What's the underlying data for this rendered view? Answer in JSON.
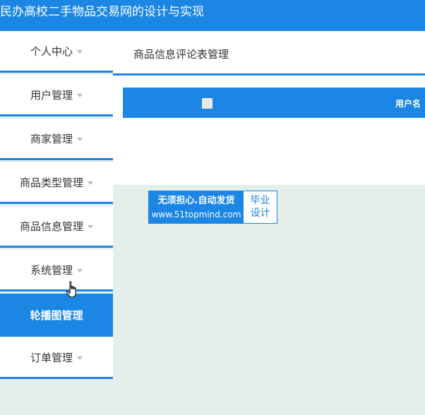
{
  "app": {
    "title": "民办高校二手物品交易网的设计与实现"
  },
  "sidebar": {
    "items": [
      {
        "label": "个人中心",
        "has_caret": true
      },
      {
        "label": "用户管理",
        "has_caret": true
      },
      {
        "label": "商家管理",
        "has_caret": true
      },
      {
        "label": "商品类型管理",
        "has_caret": true
      },
      {
        "label": "商品信息管理",
        "has_caret": true
      },
      {
        "label": "系统管理",
        "has_caret": true
      },
      {
        "label": "轮播图管理",
        "has_caret": false,
        "active": true
      },
      {
        "label": "订单管理",
        "has_caret": true
      }
    ]
  },
  "main": {
    "breadcrumb": "商品信息评论表管理",
    "table": {
      "columns": [
        "用户名"
      ]
    }
  },
  "watermark": {
    "line1": "无须担心.自动发货",
    "line2": "www.51topmind.com",
    "right1": "毕业",
    "right2": "设计"
  },
  "colors": {
    "primary": "#1b86e3",
    "background": "#e4efec"
  },
  "icons": {
    "menu_caret": "caret-down-icon",
    "pointer": "hand-cursor-icon"
  }
}
